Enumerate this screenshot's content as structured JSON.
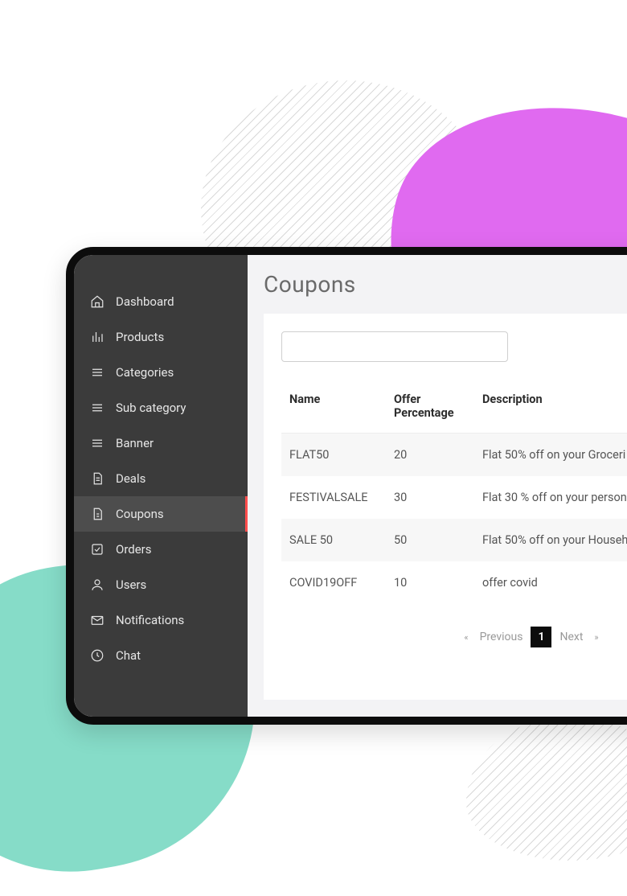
{
  "sidebar": {
    "items": [
      {
        "label": "Dashboard"
      },
      {
        "label": "Products"
      },
      {
        "label": "Categories"
      },
      {
        "label": "Sub category"
      },
      {
        "label": "Banner"
      },
      {
        "label": "Deals"
      },
      {
        "label": "Coupons"
      },
      {
        "label": "Orders"
      },
      {
        "label": "Users"
      },
      {
        "label": "Notifications"
      },
      {
        "label": "Chat"
      }
    ]
  },
  "page": {
    "title": "Coupons",
    "search_value": ""
  },
  "table": {
    "headers": {
      "name": "Name",
      "offer": "Offer Percentage",
      "desc": "Description"
    },
    "rows": [
      {
        "name": "FLAT50",
        "offer": "20",
        "desc": "Flat 50% off on your Groceri"
      },
      {
        "name": "FESTIVALSALE",
        "offer": "30",
        "desc": "Flat 30 % off on your person"
      },
      {
        "name": "SALE 50",
        "offer": "50",
        "desc": "Flat 50% off on your Househ"
      },
      {
        "name": "COVID19OFF",
        "offer": "10",
        "desc": "offer covid"
      }
    ]
  },
  "pagination": {
    "prev": "Previous",
    "next": "Next",
    "current": "1"
  }
}
